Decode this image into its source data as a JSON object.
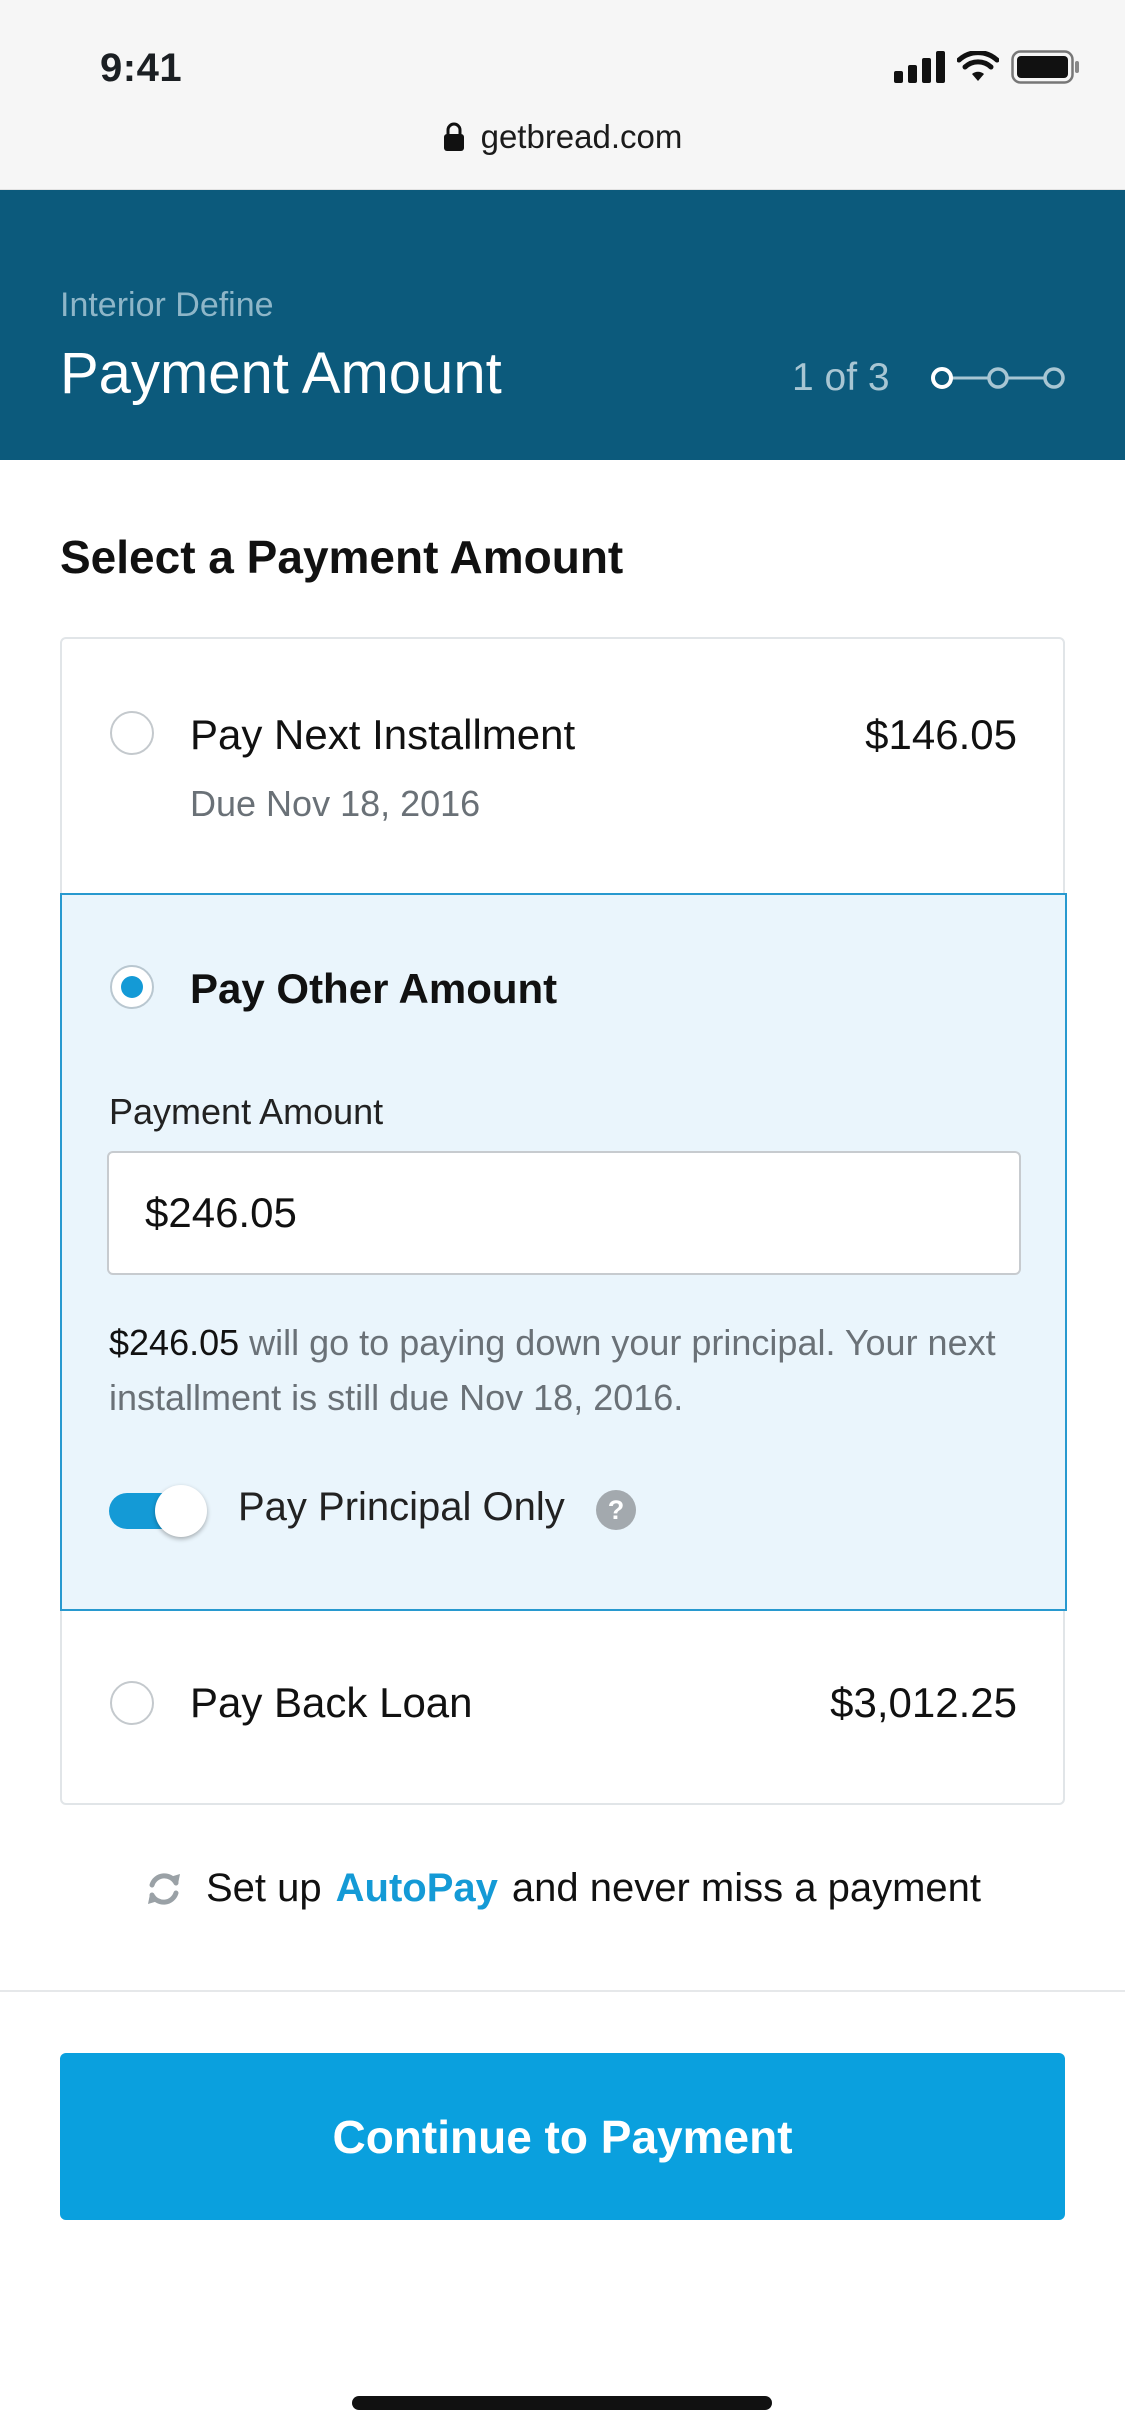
{
  "status_bar": {
    "time": "9:41",
    "url": "getbread.com"
  },
  "header": {
    "eyebrow": "Interior Define",
    "title": "Payment Amount",
    "step_text": "1 of 3"
  },
  "section_title": "Select a Payment Amount",
  "options": {
    "next_installment": {
      "label": "Pay Next Installment",
      "sub": "Due Nov 18, 2016",
      "amount": "$146.05",
      "selected": false
    },
    "other_amount": {
      "label": "Pay Other Amount",
      "selected": true,
      "field_label": "Payment Amount",
      "input_value": "$246.05",
      "note_amount": "$246.05",
      "note_text": " will go to paying down your principal. Your next installment is still due Nov 18, 2016.",
      "toggle_label": "Pay Principal Only",
      "toggle_on": true
    },
    "pay_back_loan": {
      "label": "Pay Back Loan",
      "amount": "$3,012.25",
      "selected": false
    }
  },
  "autopay": {
    "prefix": "Set up",
    "link": "AutoPay",
    "suffix": "and never miss a payment"
  },
  "cta": {
    "label": "Continue to Payment"
  },
  "colors": {
    "header_bg": "#0c5a7c",
    "accent": "#149ad6",
    "cta_bg": "#0aa0de",
    "selected_bg": "#eaf5fc"
  },
  "icons": {
    "lock": "lock-icon",
    "signal": "signal-icon",
    "wifi": "wifi-icon",
    "battery": "battery-icon",
    "help": "question-icon",
    "refresh": "refresh-icon"
  }
}
